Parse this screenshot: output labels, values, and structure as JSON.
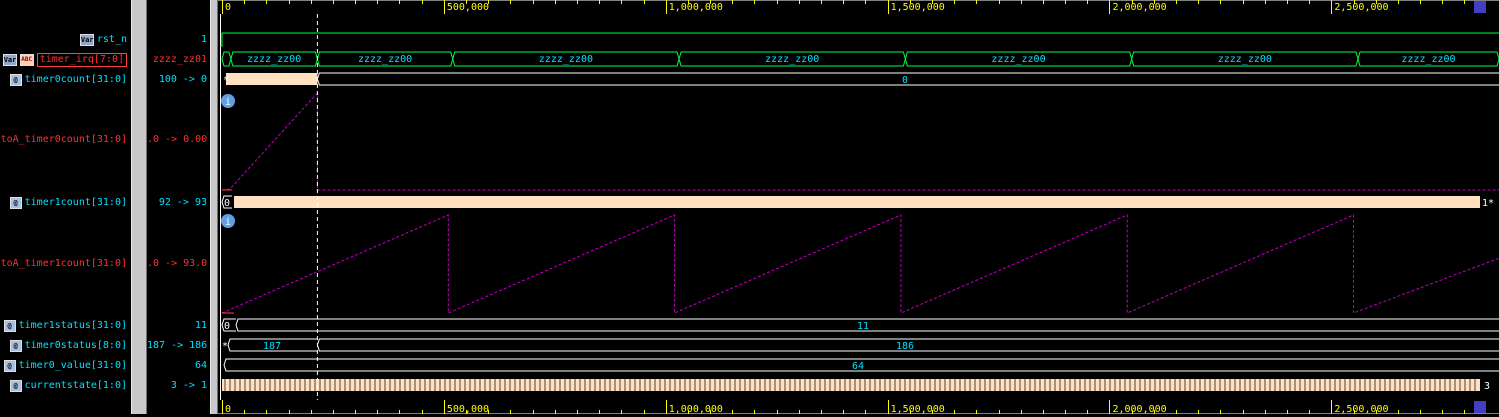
{
  "signals": [
    {
      "name": "rst_n",
      "value": "1",
      "color": "cyan",
      "icon": "var-icon",
      "icon_label": "Var"
    },
    {
      "name": "timer_irq[7:0]",
      "value": "zzzz_zz01",
      "color": "red",
      "icon": "var-icon",
      "icon_label": "Var",
      "icon2": "bus-tag-icon",
      "icon2_label": "ABC",
      "boxed": true
    },
    {
      "name": "timer0count[31:0]",
      "value": "100 -> 0",
      "color": "cyan",
      "icon": "analog-icon",
      "icon_label": "@"
    },
    {
      "name": "toA_timer0count[31:0]",
      "value": ".0 -> 0.00",
      "color": "red"
    },
    {
      "name": "timer1count[31:0]",
      "value": "92 -> 93",
      "color": "cyan",
      "icon": "analog-icon",
      "icon_label": "@"
    },
    {
      "name": "toA_timer1count[31:0]",
      "value": ".0 -> 93.0",
      "color": "red"
    },
    {
      "name": "timer1status[31:0]",
      "value": "11",
      "color": "cyan",
      "icon": "analog-icon",
      "icon_label": "@"
    },
    {
      "name": "timer0status[8:0]",
      "value": "187 -> 186",
      "color": "cyan",
      "icon": "analog-icon",
      "icon_label": "@"
    },
    {
      "name": "timer0_value[31:0]",
      "value": "64",
      "color": "cyan",
      "icon": "analog-icon",
      "icon_label": "@"
    },
    {
      "name": "currentstate[1:0]",
      "value": "3 -> 1",
      "color": "cyan",
      "icon": "analog-icon",
      "icon_label": "@"
    }
  ],
  "ruler": {
    "ticks": [
      0,
      500000,
      1000000,
      1500000,
      2000000,
      2500000
    ],
    "labels": [
      "0",
      "500,000",
      "1,000,000",
      "1,500,000",
      "2,000,000",
      "2,500,000"
    ],
    "max": 2835000
  },
  "cursor_time": 215000,
  "waves": {
    "timer_irq_segments": {
      "boundaries": [
        0,
        20000,
        215000,
        520000,
        1030000,
        1540000,
        2050000,
        2560000,
        2835000
      ],
      "label": "zzzz_zz00"
    },
    "timer0count_value": "0",
    "timer0count_start": "*",
    "timer1count_start": "0",
    "timer1count_end": "1*",
    "timer1count_ramp_period": 510000,
    "timer1status_start": "0",
    "timer1status_value": "11",
    "timer0status_first": "187",
    "timer0status_second": "186",
    "timer0status_start": "*",
    "timer0_value_value": "64",
    "currentstate_end": "3",
    "info_icon_label": "i"
  },
  "colors": {
    "grid": "#ffff00",
    "wave": "#00ff40",
    "bus": "#00ff40",
    "busy": "#ffe0c0",
    "analog": "#c000c0",
    "text": "#00e0ff",
    "cursor": "#ffffff"
  }
}
